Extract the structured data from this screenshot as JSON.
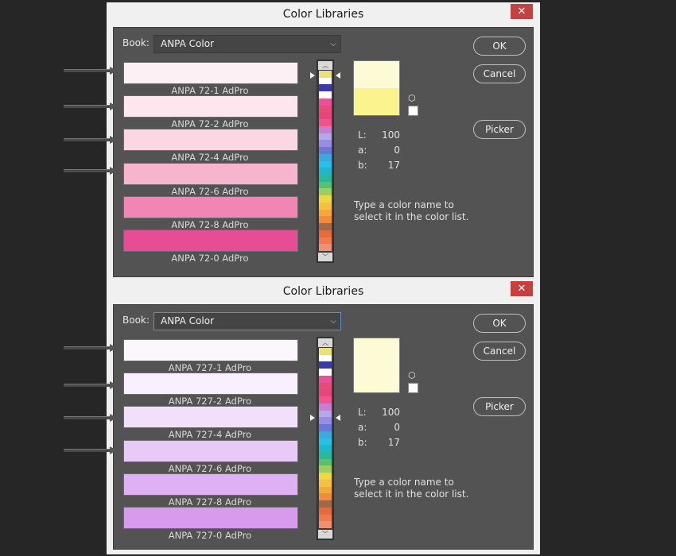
{
  "dialogs": [
    {
      "title": "Color Libraries",
      "close": "✕",
      "book_label": "Book:",
      "book_value": "ANPA Color",
      "swatches": [
        {
          "label": "ANPA 72-1 AdPro",
          "color": "#fdf0f4"
        },
        {
          "label": "ANPA 72-2 AdPro",
          "color": "#fde6ee"
        },
        {
          "label": "ANPA 72-4 AdPro",
          "color": "#fcd7e3"
        },
        {
          "label": "ANPA 72-6 AdPro",
          "color": "#f8b3cf"
        },
        {
          "label": "ANPA 72-8 AdPro",
          "color": "#f186b4"
        },
        {
          "label": "ANPA 72-0 AdPro",
          "color": "#e64d95"
        }
      ],
      "preview_top_color": "#fdfbd6",
      "preview_bottom_color": "#fbf48e",
      "lab": {
        "L_label": "L:",
        "L": "100",
        "a_label": "a:",
        "a": "0",
        "b_label": "b:",
        "b": "17"
      },
      "hint": "Type a color name to select it in the color list.",
      "buttons": {
        "ok": "OK",
        "cancel": "Cancel",
        "picker": "Picker"
      }
    },
    {
      "title": "Color Libraries",
      "close": "✕",
      "book_label": "Book:",
      "book_value": "ANPA Color",
      "swatches": [
        {
          "label": "ANPA 727-1 AdPro",
          "color": "#fcf7fd"
        },
        {
          "label": "ANPA 727-2 AdPro",
          "color": "#faeffc"
        },
        {
          "label": "ANPA 727-4 AdPro",
          "color": "#f2e0fa"
        },
        {
          "label": "ANPA 727-6 AdPro",
          "color": "#e9c9f7"
        },
        {
          "label": "ANPA 727-8 AdPro",
          "color": "#dfb0f2"
        },
        {
          "label": "ANPA 727-0 AdPro",
          "color": "#d79aed"
        }
      ],
      "preview_top_color": "#fdfbd6",
      "preview_bottom_color": "#fdfbd6",
      "lab": {
        "L_label": "L:",
        "L": "100",
        "a_label": "a:",
        "a": "0",
        "b_label": "b:",
        "b": "17"
      },
      "hint": "Type a color name to select it in the color list.",
      "buttons": {
        "ok": "OK",
        "cancel": "Cancel",
        "picker": "Picker"
      }
    }
  ],
  "strip_colors": [
    "#eadf7a",
    "#ffffff",
    "#3a3aa8",
    "#ffffff",
    "#e8509a",
    "#e84a7a",
    "#e8467a",
    "#ef5390",
    "#c67fd0",
    "#b4a8e8",
    "#9a8ce2",
    "#6a78d8",
    "#3da8e0",
    "#27c0e8",
    "#20b8c8",
    "#28b89a",
    "#58c070",
    "#9ad060",
    "#f0d640",
    "#f6c040",
    "#f4a838",
    "#f08c3c",
    "#a06a4a",
    "#e86a3a",
    "#f07a50",
    "#f09070"
  ]
}
